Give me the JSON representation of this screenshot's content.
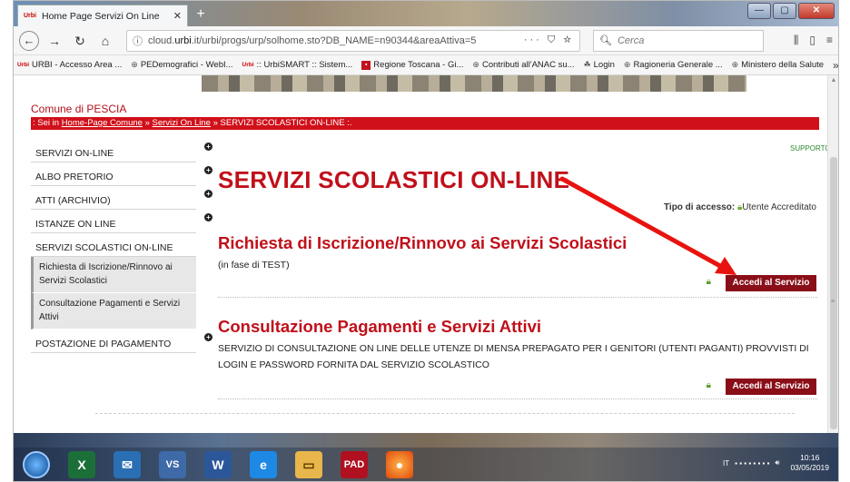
{
  "browser": {
    "tab_title": "Home Page Servizi On Line",
    "tab_favicon": "urbi",
    "url_domain_prefix": "cloud.",
    "url_domain": "urbi",
    "url_rest": ".it/urbi/progs/urp/solhome.sto?DB_NAME=n90344&areaAttiva=5",
    "url_actions": "··· ⛉ ☆",
    "search_placeholder": "Cerca"
  },
  "bookmarks": [
    {
      "label": "URBI - Accesso Area ..."
    },
    {
      "label": "PEDemografici - WebI..."
    },
    {
      "label": ":: UrbiSMART :: Sistem..."
    },
    {
      "label": "Regione Toscana - Gi..."
    },
    {
      "label": "Contributi all'ANAC su..."
    },
    {
      "label": "Login"
    },
    {
      "label": "Ragioneria Generale ..."
    },
    {
      "label": "Ministero della Salute"
    }
  ],
  "page": {
    "comune": "Comune di PESCIA",
    "breadcrumb_prefix": ": Sei in",
    "breadcrumb_home": "Home-Page Comune",
    "breadcrumb_sep1": "»",
    "breadcrumb_servizi": "Servizi On Line",
    "breadcrumb_sep2": "»",
    "breadcrumb_current": "SERVIZI SCOLASTICI ON-LINE :.",
    "supporto": "SUPPORTO",
    "heading": "SERVIZI SCOLASTICI ON-LINE",
    "access_label": "Tipo di accesso:",
    "access_value": "Utente Accreditato"
  },
  "sidebar": [
    {
      "label": "SERVIZI ON-LINE",
      "expand": "+"
    },
    {
      "label": "ALBO PRETORIO",
      "expand": "+"
    },
    {
      "label": "ATTI (ARCHIVIO)",
      "expand": "+"
    },
    {
      "label": "ISTANZE ON LINE",
      "expand": "+"
    },
    {
      "label": "SERVIZI SCOLASTICI ON-LINE"
    }
  ],
  "sidebar_sub": [
    {
      "label": "Richiesta di Iscrizione/Rinnovo ai Servizi Scolastici"
    },
    {
      "label": "Consultazione Pagamenti e Servizi Attivi"
    }
  ],
  "sidebar_last": {
    "label": "POSTAZIONE DI PAGAMENTO",
    "expand": "+"
  },
  "services": [
    {
      "title": "Richiesta di Iscrizione/Rinnovo ai Servizi Scolastici",
      "description": "(in fase di TEST)",
      "button": "Accedi al Servizio"
    },
    {
      "title": "Consultazione Pagamenti e Servizi Attivi",
      "description": "SERVIZIO DI CONSULTAZIONE ON LINE DELLE UTENZE DI MENSA PREPAGATO PER I GENITORI (UTENTI PAGANTI) PROVVISTI DI LOGIN E PASSWORD FORNITA DAL SERVIZIO SCOLASTICO",
      "button": "Accedi al Servizio"
    }
  ],
  "taskbar": {
    "lang": "IT",
    "time": "10:16",
    "date": "03/05/2019",
    "apps": [
      "excel",
      "thunderbird",
      "vs",
      "word",
      "ie",
      "explorer",
      "pad",
      "firefox"
    ]
  },
  "colors": {
    "accent_red": "#c0101a",
    "button_red": "#8a0e18",
    "crumb_red": "#d0101a"
  }
}
